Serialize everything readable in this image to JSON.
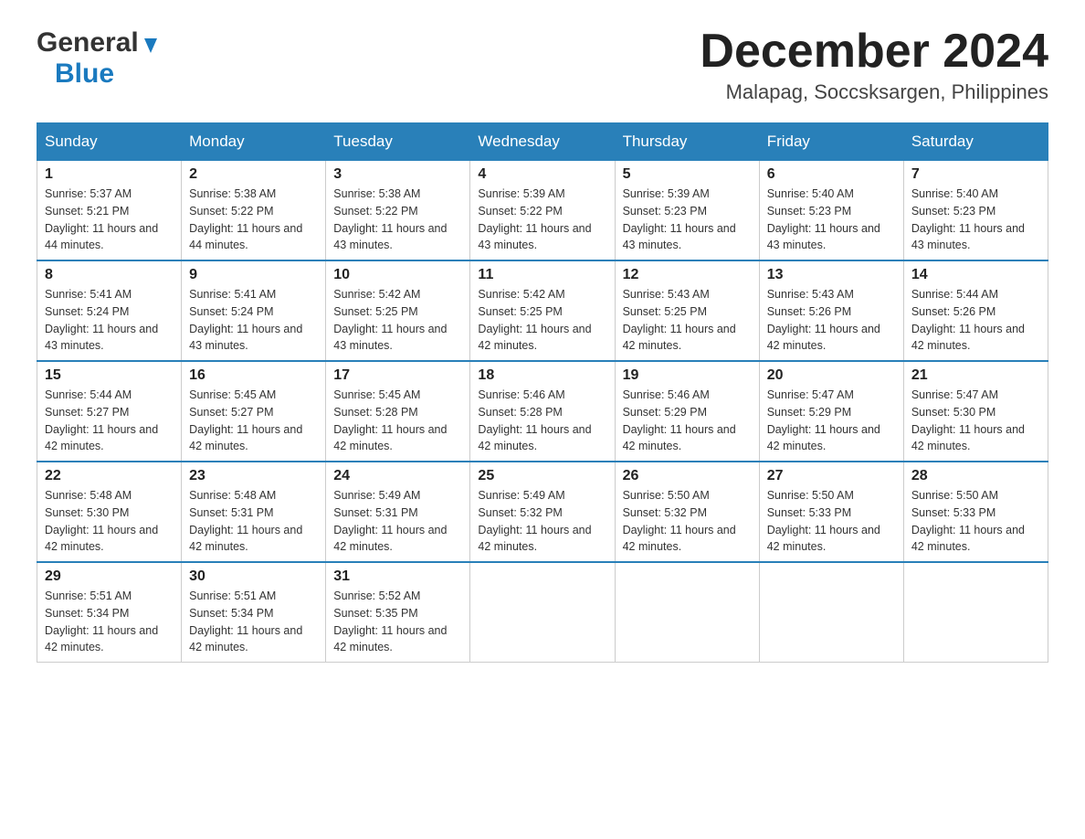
{
  "header": {
    "month_title": "December 2024",
    "location": "Malapag, Soccsksargen, Philippines"
  },
  "logo": {
    "general": "General",
    "blue": "Blue"
  },
  "days_of_week": [
    "Sunday",
    "Monday",
    "Tuesday",
    "Wednesday",
    "Thursday",
    "Friday",
    "Saturday"
  ],
  "weeks": [
    [
      {
        "date": "1",
        "sunrise": "5:37 AM",
        "sunset": "5:21 PM",
        "daylight": "11 hours and 44 minutes."
      },
      {
        "date": "2",
        "sunrise": "5:38 AM",
        "sunset": "5:22 PM",
        "daylight": "11 hours and 44 minutes."
      },
      {
        "date": "3",
        "sunrise": "5:38 AM",
        "sunset": "5:22 PM",
        "daylight": "11 hours and 43 minutes."
      },
      {
        "date": "4",
        "sunrise": "5:39 AM",
        "sunset": "5:22 PM",
        "daylight": "11 hours and 43 minutes."
      },
      {
        "date": "5",
        "sunrise": "5:39 AM",
        "sunset": "5:23 PM",
        "daylight": "11 hours and 43 minutes."
      },
      {
        "date": "6",
        "sunrise": "5:40 AM",
        "sunset": "5:23 PM",
        "daylight": "11 hours and 43 minutes."
      },
      {
        "date": "7",
        "sunrise": "5:40 AM",
        "sunset": "5:23 PM",
        "daylight": "11 hours and 43 minutes."
      }
    ],
    [
      {
        "date": "8",
        "sunrise": "5:41 AM",
        "sunset": "5:24 PM",
        "daylight": "11 hours and 43 minutes."
      },
      {
        "date": "9",
        "sunrise": "5:41 AM",
        "sunset": "5:24 PM",
        "daylight": "11 hours and 43 minutes."
      },
      {
        "date": "10",
        "sunrise": "5:42 AM",
        "sunset": "5:25 PM",
        "daylight": "11 hours and 43 minutes."
      },
      {
        "date": "11",
        "sunrise": "5:42 AM",
        "sunset": "5:25 PM",
        "daylight": "11 hours and 42 minutes."
      },
      {
        "date": "12",
        "sunrise": "5:43 AM",
        "sunset": "5:25 PM",
        "daylight": "11 hours and 42 minutes."
      },
      {
        "date": "13",
        "sunrise": "5:43 AM",
        "sunset": "5:26 PM",
        "daylight": "11 hours and 42 minutes."
      },
      {
        "date": "14",
        "sunrise": "5:44 AM",
        "sunset": "5:26 PM",
        "daylight": "11 hours and 42 minutes."
      }
    ],
    [
      {
        "date": "15",
        "sunrise": "5:44 AM",
        "sunset": "5:27 PM",
        "daylight": "11 hours and 42 minutes."
      },
      {
        "date": "16",
        "sunrise": "5:45 AM",
        "sunset": "5:27 PM",
        "daylight": "11 hours and 42 minutes."
      },
      {
        "date": "17",
        "sunrise": "5:45 AM",
        "sunset": "5:28 PM",
        "daylight": "11 hours and 42 minutes."
      },
      {
        "date": "18",
        "sunrise": "5:46 AM",
        "sunset": "5:28 PM",
        "daylight": "11 hours and 42 minutes."
      },
      {
        "date": "19",
        "sunrise": "5:46 AM",
        "sunset": "5:29 PM",
        "daylight": "11 hours and 42 minutes."
      },
      {
        "date": "20",
        "sunrise": "5:47 AM",
        "sunset": "5:29 PM",
        "daylight": "11 hours and 42 minutes."
      },
      {
        "date": "21",
        "sunrise": "5:47 AM",
        "sunset": "5:30 PM",
        "daylight": "11 hours and 42 minutes."
      }
    ],
    [
      {
        "date": "22",
        "sunrise": "5:48 AM",
        "sunset": "5:30 PM",
        "daylight": "11 hours and 42 minutes."
      },
      {
        "date": "23",
        "sunrise": "5:48 AM",
        "sunset": "5:31 PM",
        "daylight": "11 hours and 42 minutes."
      },
      {
        "date": "24",
        "sunrise": "5:49 AM",
        "sunset": "5:31 PM",
        "daylight": "11 hours and 42 minutes."
      },
      {
        "date": "25",
        "sunrise": "5:49 AM",
        "sunset": "5:32 PM",
        "daylight": "11 hours and 42 minutes."
      },
      {
        "date": "26",
        "sunrise": "5:50 AM",
        "sunset": "5:32 PM",
        "daylight": "11 hours and 42 minutes."
      },
      {
        "date": "27",
        "sunrise": "5:50 AM",
        "sunset": "5:33 PM",
        "daylight": "11 hours and 42 minutes."
      },
      {
        "date": "28",
        "sunrise": "5:50 AM",
        "sunset": "5:33 PM",
        "daylight": "11 hours and 42 minutes."
      }
    ],
    [
      {
        "date": "29",
        "sunrise": "5:51 AM",
        "sunset": "5:34 PM",
        "daylight": "11 hours and 42 minutes."
      },
      {
        "date": "30",
        "sunrise": "5:51 AM",
        "sunset": "5:34 PM",
        "daylight": "11 hours and 42 minutes."
      },
      {
        "date": "31",
        "sunrise": "5:52 AM",
        "sunset": "5:35 PM",
        "daylight": "11 hours and 42 minutes."
      },
      null,
      null,
      null,
      null
    ]
  ]
}
